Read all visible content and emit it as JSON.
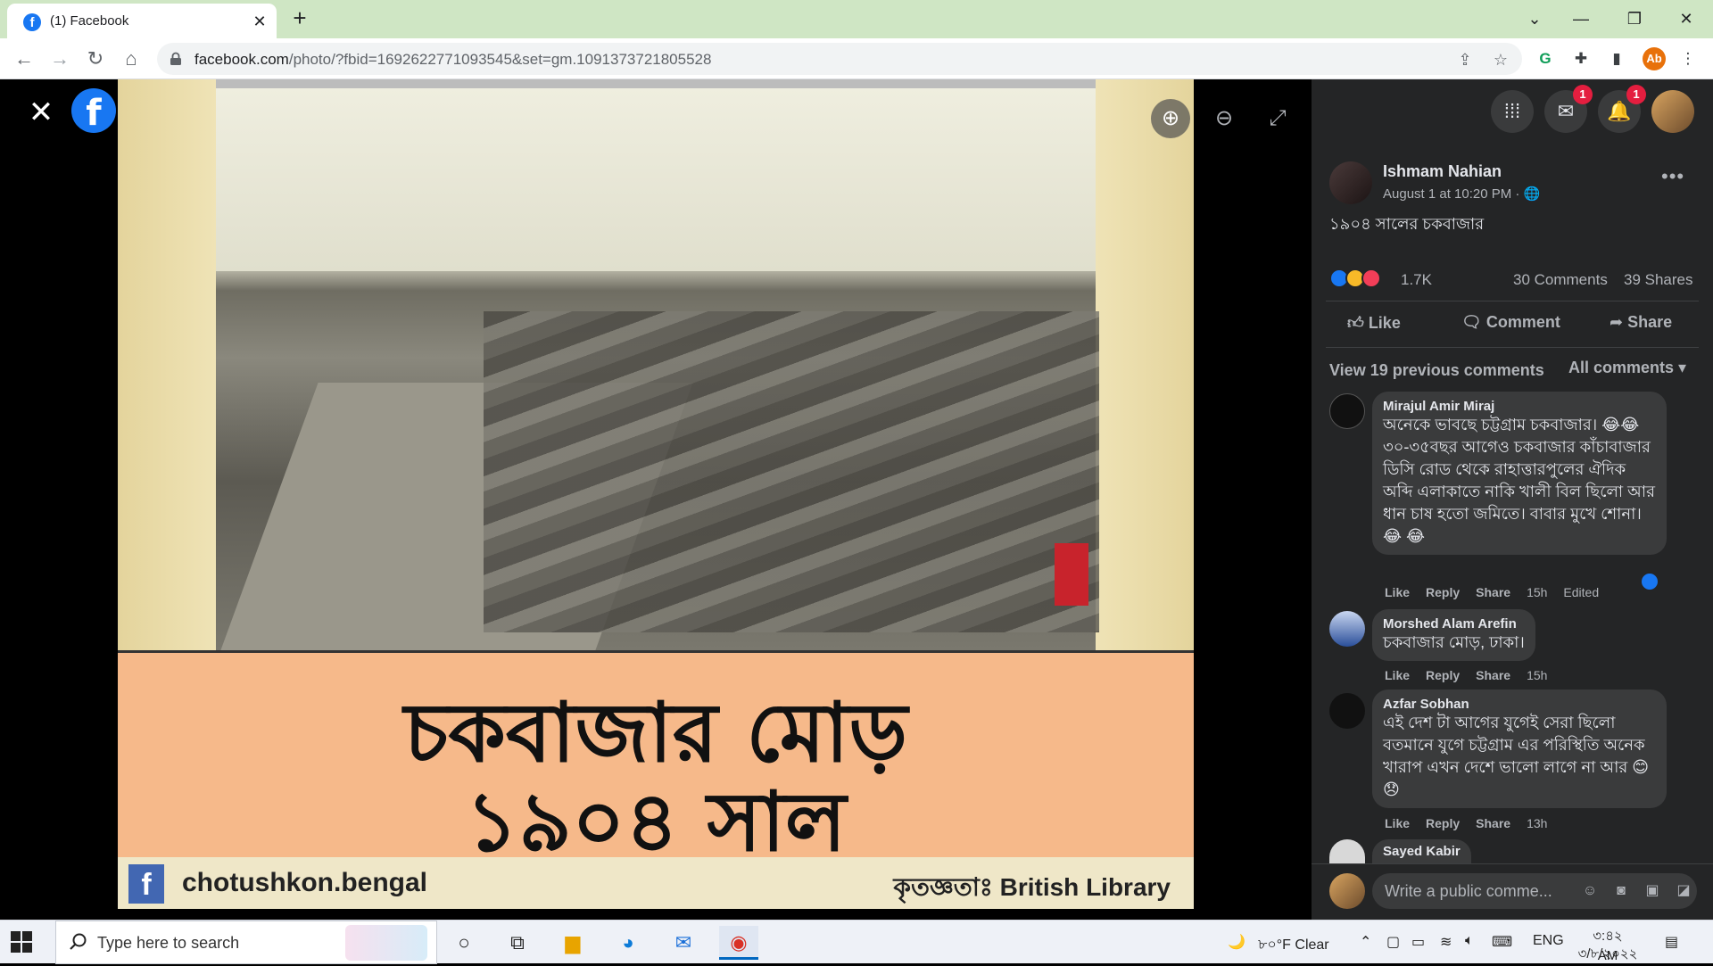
{
  "browser": {
    "tab_title": "(1) Facebook",
    "tab_close": "✕",
    "new_tab": "+",
    "url_host": "facebook.com",
    "url_path": "/photo/?fbid=1692622771093545&set=gm.1091373721805528",
    "profile_initials": "Ab"
  },
  "viewer": {
    "close": "✕",
    "fb_logo": "f",
    "image_text": {
      "banner_line1": "চকবাজার মোড়",
      "banner_line2": "১৯০৪ সাল",
      "fb_mark": "f",
      "handle": "chotushkon.bengal",
      "credit": "কৃতজ্ঞতাঃ British Library"
    }
  },
  "post": {
    "author": "Ishmam Nahian",
    "time": "August 1 at 10:20 PM ·",
    "more": "•••",
    "text": "১৯০৪ সালের চকবাজার",
    "reactions_count": "1.7K",
    "comments_count": "30 Comments",
    "shares_count": "39 Shares",
    "actions": {
      "like": "Like",
      "comment": "Comment",
      "share": "Share"
    },
    "view_previous": "View 19 previous comments",
    "comment_filter": "All comments"
  },
  "comments": [
    {
      "name": "Mirajul Amir Miraj",
      "text": "অনেকে ভাবছে চট্টগ্রাম চকবাজার। 😂😂 ৩০-৩৫বছর আগেও চকবাজার কাঁচাবাজার ডিসি রোড থেকে রাহাত্তারপুলের ঐদিক অব্দি এলাকাতে নাকি খালী বিল ছিলো আর ধান চাষ হতো জমিতে। বাবার মুখে শোনা। 😂 😂",
      "like": "Like",
      "reply": "Reply",
      "share": "Share",
      "time": "15h",
      "edited": "Edited"
    },
    {
      "name": "Morshed Alam Arefin",
      "text": "চকবাজার মোড়, ঢাকা।",
      "like": "Like",
      "reply": "Reply",
      "share": "Share",
      "time": "15h"
    },
    {
      "name": "Azfar Sobhan",
      "text": "এই দেশ টা আগের যুগেই সেরা ছিলো বতমানে যুগে চট্টগ্রাম এর পরিস্থিতি অনেক খারাপ এখন দেশে ভালো লাগে না আর 😊😞",
      "like": "Like",
      "reply": "Reply",
      "share": "Share",
      "time": "13h"
    },
    {
      "name": "Sayed Kabir"
    }
  ],
  "comment_box": {
    "placeholder": "Write a public comme..."
  },
  "notifications": {
    "messenger": "1",
    "alerts": "1"
  },
  "taskbar": {
    "search_placeholder": "Type here to search",
    "weather": "৮০°F  Clear",
    "language": "ENG",
    "time": "৩:৪২ AM",
    "date": "৩/৮/২০২২"
  },
  "colors": {
    "facebook_blue": "#1877f2",
    "sidebar_bg": "#242526",
    "bubble_bg": "#3a3b3c",
    "badge_red": "#e41e3f"
  }
}
